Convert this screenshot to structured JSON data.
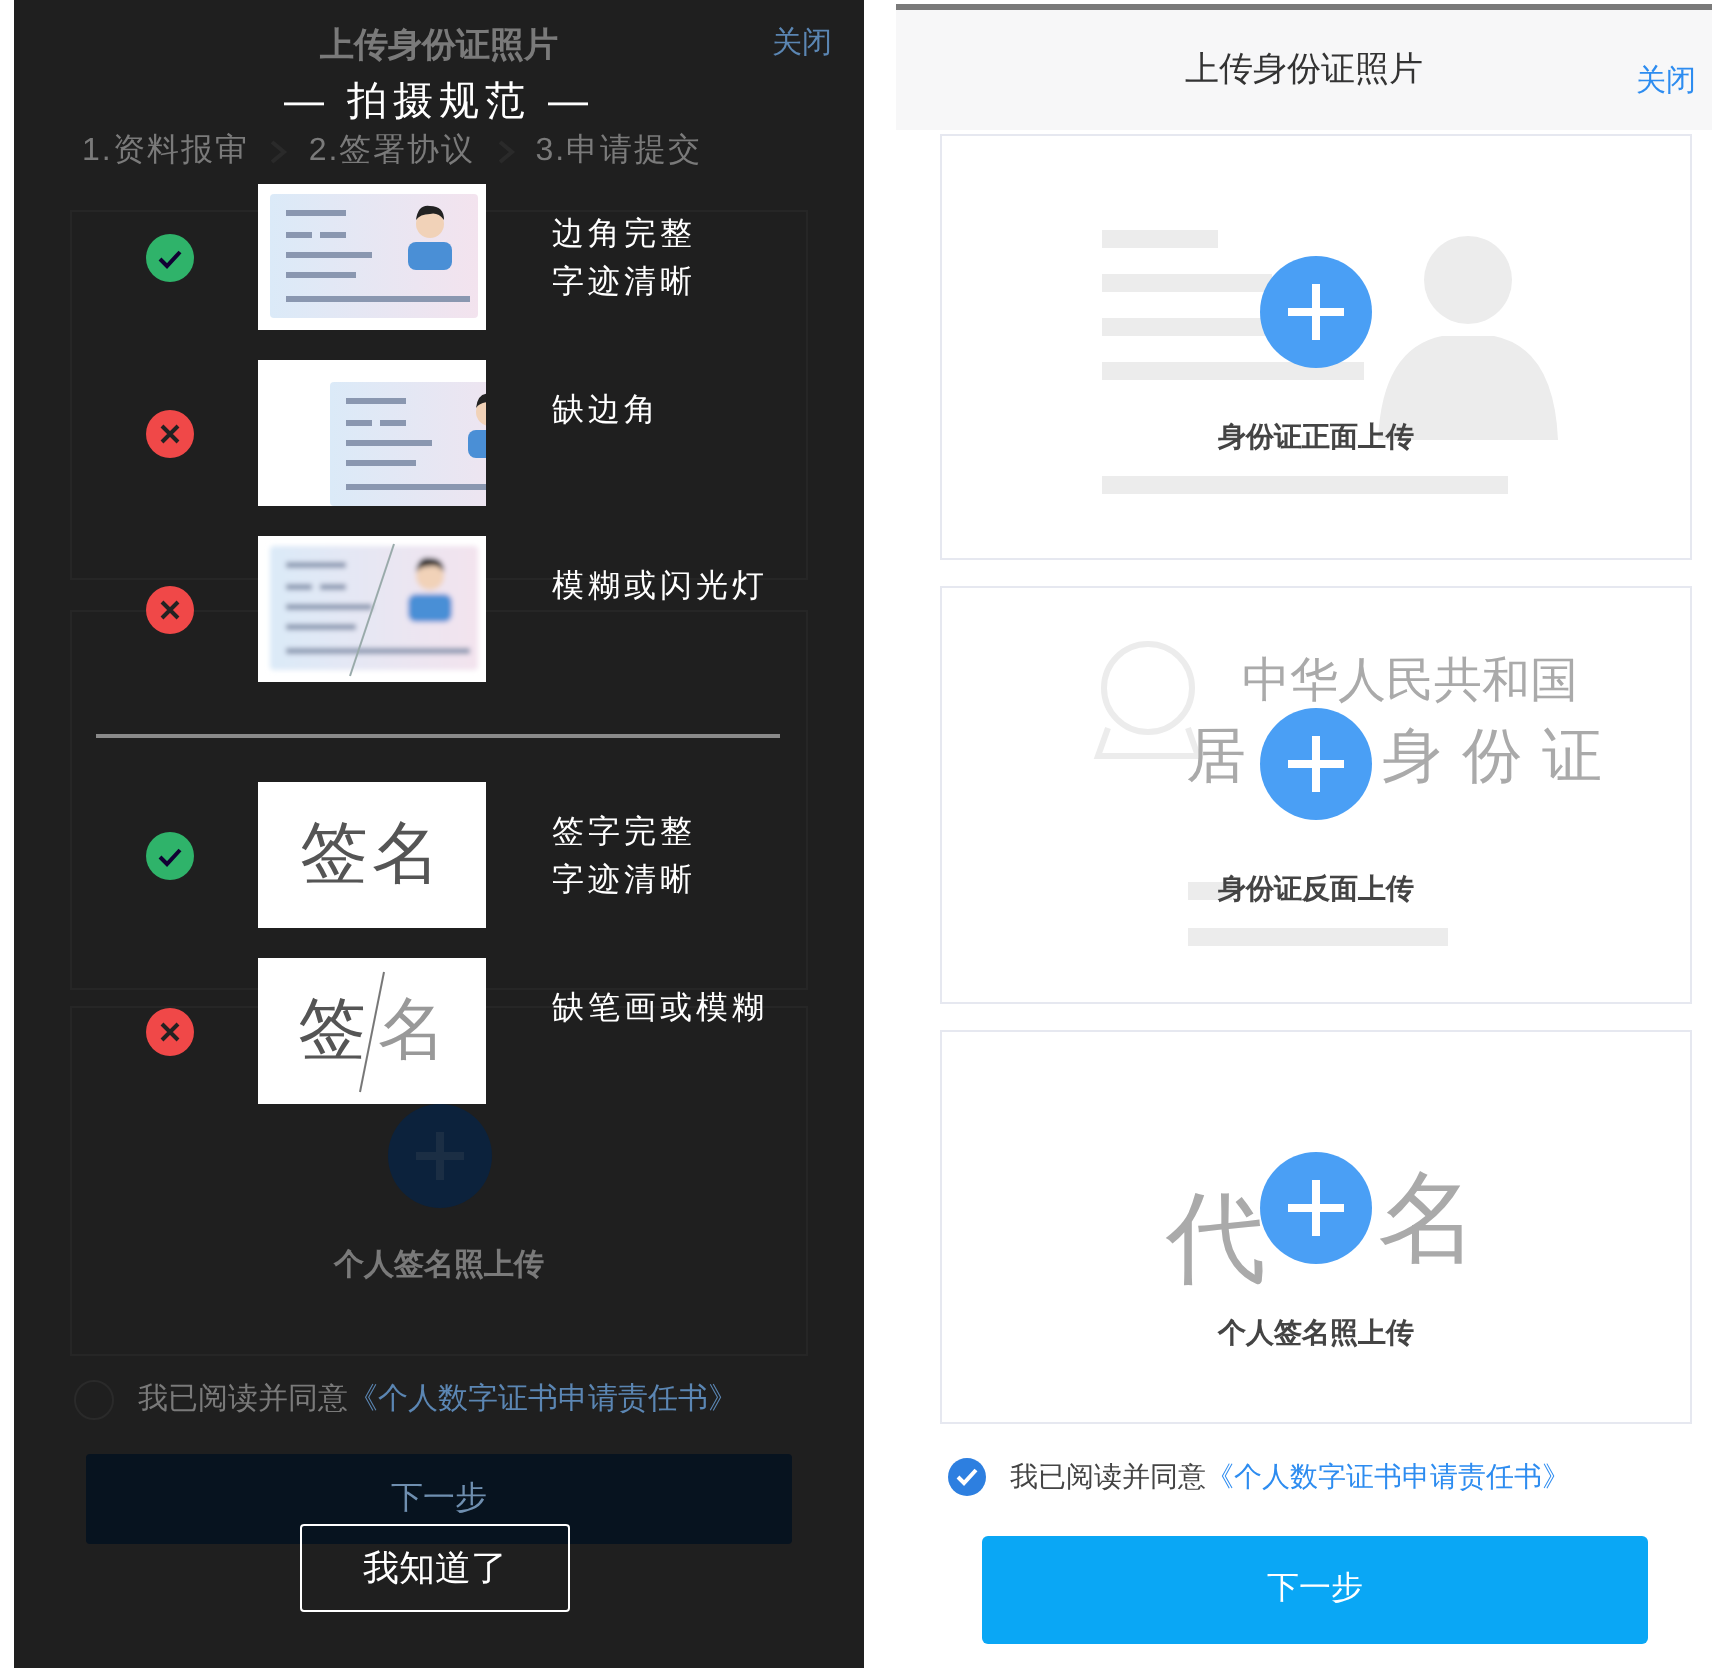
{
  "guide_screen": {
    "backdrop": {
      "header": {
        "title": "上传身份证照片",
        "close": "关闭"
      },
      "steps": [
        "1.资料报审",
        "2.签署协议",
        "3.申请提交"
      ],
      "cards": [
        {
          "kind": "hidden"
        },
        {
          "kind": "hidden"
        },
        {
          "kind": "signature",
          "label": "个人签名照上传"
        }
      ],
      "agreement": {
        "checked": false,
        "text": "我已阅读并同意",
        "link": "《个人数字证书申请责任书》"
      },
      "next_button": "下一步"
    },
    "guide": {
      "title": "— 拍摄规范 —",
      "sections": [
        {
          "items": [
            {
              "ok": true,
              "kind": "id-card-complete",
              "caption": [
                "边角完整",
                "字迹清晰"
              ]
            },
            {
              "ok": false,
              "kind": "id-card-cropped",
              "caption": [
                "缺边角"
              ]
            },
            {
              "ok": false,
              "kind": "id-card-blurred",
              "caption": [
                "模糊或闪光灯"
              ]
            }
          ]
        },
        {
          "items": [
            {
              "ok": true,
              "kind": "signature-clear",
              "sample": [
                "签名"
              ],
              "caption": [
                "签字完整",
                "字迹清晰"
              ]
            },
            {
              "ok": false,
              "kind": "signature-broken",
              "sample": [
                "签",
                "名"
              ],
              "caption": [
                "缺笔画或模糊"
              ]
            }
          ]
        }
      ],
      "confirm_button": "我知道了"
    }
  },
  "upload_screen": {
    "header": {
      "title": "上传身份证照片",
      "close": "关闭"
    },
    "upload_cards": [
      {
        "kind": "id-front",
        "label": "身份证正面上传"
      },
      {
        "kind": "id-back",
        "label": "身份证反面上传",
        "art_text": [
          "中华人民共和国",
          "居",
          "身份证"
        ]
      },
      {
        "kind": "signature",
        "label": "个人签名照上传",
        "art_text": [
          "代",
          "名"
        ]
      }
    ],
    "agreement": {
      "checked": true,
      "text": "我已阅读并同意",
      "link": "《个人数字证书申请责任书》"
    },
    "next_button": "下一步"
  }
}
